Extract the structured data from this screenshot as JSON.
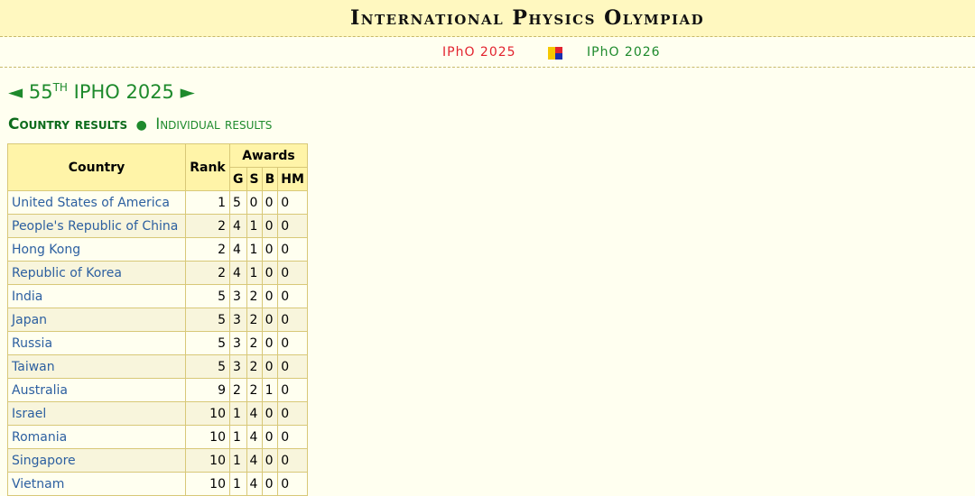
{
  "header": {
    "title": "International Physics Olympiad"
  },
  "subnav": {
    "ipho2025": "IPhO 2025",
    "ipho2026": "IPhO 2026",
    "logo_icon": "ipho-logo-icon",
    "colors": {
      "red": "#e2232e",
      "green": "#1e8a2c",
      "yellow": "#f5c800",
      "blue": "#1a2fb0"
    }
  },
  "edition": {
    "prev_arrow": "◄",
    "number": "55",
    "suffix": "TH",
    "name": "IPHO 2025",
    "next_arrow": "►"
  },
  "results_nav": {
    "country": "Country results",
    "separator": "●",
    "individual": "Individual results"
  },
  "table": {
    "headers": {
      "country": "Country",
      "rank": "Rank",
      "awards": "Awards",
      "g": "G",
      "s": "S",
      "b": "B",
      "hm": "HM"
    },
    "rows": [
      {
        "country": "United States of America",
        "rank": "1",
        "g": "5",
        "s": "0",
        "b": "0",
        "hm": "0"
      },
      {
        "country": "People's Republic of China",
        "rank": "2",
        "g": "4",
        "s": "1",
        "b": "0",
        "hm": "0"
      },
      {
        "country": "Hong Kong",
        "rank": "2",
        "g": "4",
        "s": "1",
        "b": "0",
        "hm": "0"
      },
      {
        "country": "Republic of Korea",
        "rank": "2",
        "g": "4",
        "s": "1",
        "b": "0",
        "hm": "0"
      },
      {
        "country": "India",
        "rank": "5",
        "g": "3",
        "s": "2",
        "b": "0",
        "hm": "0"
      },
      {
        "country": "Japan",
        "rank": "5",
        "g": "3",
        "s": "2",
        "b": "0",
        "hm": "0"
      },
      {
        "country": "Russia",
        "rank": "5",
        "g": "3",
        "s": "2",
        "b": "0",
        "hm": "0"
      },
      {
        "country": "Taiwan",
        "rank": "5",
        "g": "3",
        "s": "2",
        "b": "0",
        "hm": "0"
      },
      {
        "country": "Australia",
        "rank": "9",
        "g": "2",
        "s": "2",
        "b": "1",
        "hm": "0"
      },
      {
        "country": "Israel",
        "rank": "10",
        "g": "1",
        "s": "4",
        "b": "0",
        "hm": "0"
      },
      {
        "country": "Romania",
        "rank": "10",
        "g": "1",
        "s": "4",
        "b": "0",
        "hm": "0"
      },
      {
        "country": "Singapore",
        "rank": "10",
        "g": "1",
        "s": "4",
        "b": "0",
        "hm": "0"
      },
      {
        "country": "Vietnam",
        "rank": "10",
        "g": "1",
        "s": "4",
        "b": "0",
        "hm": "0"
      }
    ]
  }
}
